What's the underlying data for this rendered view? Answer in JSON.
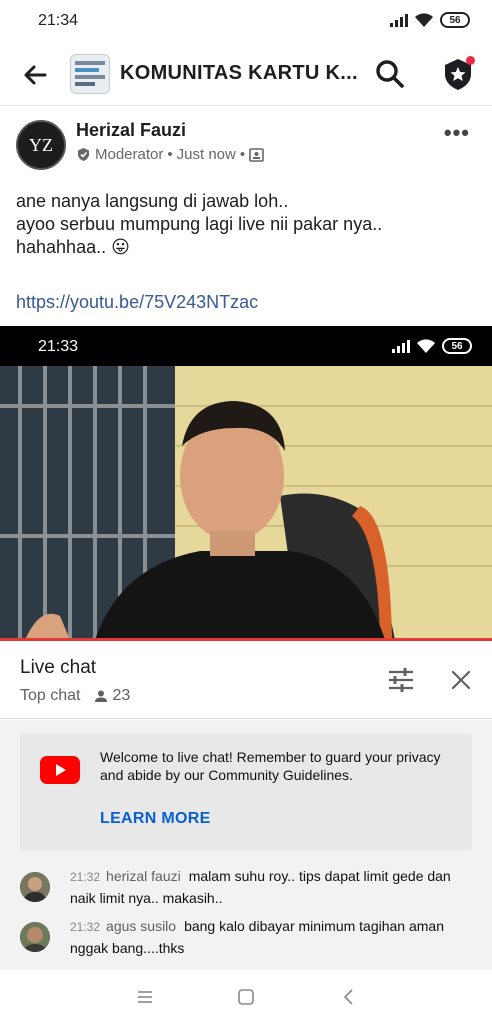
{
  "status_bar": {
    "time": "21:34",
    "battery": "56"
  },
  "app_bar": {
    "title": "KOMUNITAS KARTU K..."
  },
  "post": {
    "author": "Herizal Fauzi",
    "role": "Moderator",
    "separator": "•",
    "time": "Just now",
    "avatar_letters": "YZ",
    "more": "•••",
    "body_lines": [
      "ane nanya langsung di jawab loh..",
      "ayoo serbuu mumpung lagi live nii pakar nya..",
      "hahahhaa.. 😛"
    ],
    "link": "https://youtu.be/75V243NTzac"
  },
  "video": {
    "status_time": "21:33",
    "battery": "56"
  },
  "live_chat": {
    "title": "Live chat",
    "mode": "Top chat",
    "viewers": "23",
    "welcome_text": "Welcome to live chat! Remember to guard your privacy and abide by our Community Guidelines.",
    "learn_more": "LEARN MORE",
    "messages": [
      {
        "time": "21:32",
        "author": "herizal fauzi",
        "text": "malam suhu roy.. tips dapat limit gede dan naik limit nya.. makasih.."
      },
      {
        "time": "21:32",
        "author": "agus susilo",
        "text": "bang kalo dibayar minimum tagihan aman nggak bang....thks"
      }
    ]
  },
  "colors": {
    "link": "#385898",
    "youtube_red": "#ff0000",
    "learn_more": "#065fd4",
    "notification_dot": "#f02849"
  }
}
